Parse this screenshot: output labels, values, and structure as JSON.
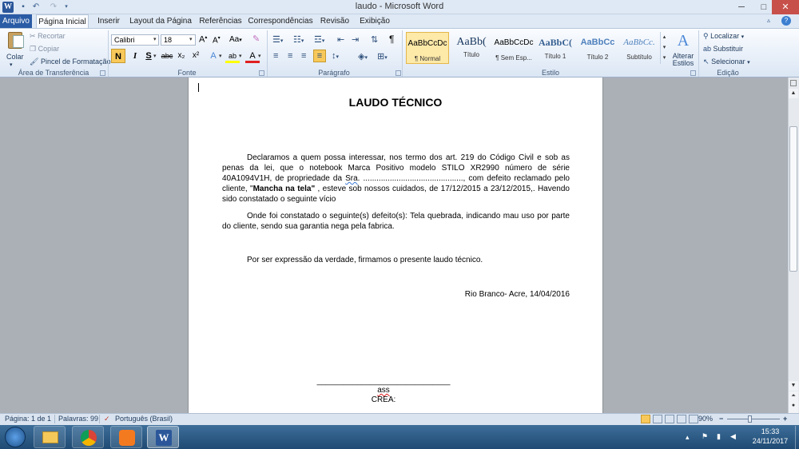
{
  "window": {
    "title": "laudo - Microsoft Word",
    "minimize": "─",
    "maximize": "□",
    "close": "✕"
  },
  "qat": {
    "app_icon": "W",
    "save": "💾",
    "undo": "↶",
    "redo": "↷"
  },
  "tabs": [
    {
      "label": "Arquivo"
    },
    {
      "label": "Página Inicial"
    },
    {
      "label": "Inserir"
    },
    {
      "label": "Layout da Página"
    },
    {
      "label": "Referências"
    },
    {
      "label": "Correspondências"
    },
    {
      "label": "Revisão"
    },
    {
      "label": "Exibição"
    }
  ],
  "ribbon": {
    "clipboard": {
      "group": "Área de Transferência",
      "paste": "Colar",
      "cut": "Recortar",
      "copy": "Copiar",
      "format_painter": "Pincel de Formatação"
    },
    "font": {
      "group": "Fonte",
      "font_name": "Calibri",
      "font_size": "18",
      "bold": "N",
      "italic": "I",
      "underline": "S",
      "strike": "abc",
      "sub": "x₂",
      "sup": "x²",
      "grow": "A",
      "shrink": "A",
      "case": "Aa",
      "effects": "A",
      "highlight": "ab",
      "color": "A"
    },
    "paragraph": {
      "group": "Parágrafo",
      "show_marks": "¶"
    },
    "styles": {
      "group": "Estilo",
      "change": "Alterar Estilos",
      "items": [
        {
          "preview": "AaBbCcDc",
          "name": "¶ Normal"
        },
        {
          "preview": "AaBb(",
          "name": "Título"
        },
        {
          "preview": "AaBbCcDc",
          "name": "¶ Sem Esp..."
        },
        {
          "preview": "AaBbC(",
          "name": "Título 1"
        },
        {
          "preview": "AaBbCc",
          "name": "Título 2"
        },
        {
          "preview": "AaBbCc.",
          "name": "Subtítulo"
        }
      ]
    },
    "editing": {
      "group": "Edição",
      "find": "Localizar",
      "replace": "Substituir",
      "select": "Selecionar"
    }
  },
  "document": {
    "title": "LAUDO TÉCNICO",
    "p1_a": "Declaramos a quem possa interessar, nos termo dos art. 219 do Código Civil e sob as penas da lei, que o notebook Marca Positivo modelo STILO XR2990 número de série 40A1094V1H, de propriedade da ",
    "p1_sra": "Sra",
    "p1_b": ". .............................................,  com defeito reclamado  pelo cliente, \"",
    "p1_bold": "Mancha na tela\"",
    "p1_c": " , esteve sob nossos cuidados, de 17/12/2015 a 23/12/2015,.  Havendo sido constatado o seguinte vício",
    "p2": "Onde foi constatado o seguinte(s) defeito(s): Tela quebrada, indicando mau uso por parte do cliente, sendo sua garantia nega pela fabrica.",
    "p3": "Por ser expressão da verdade, firmamos o presente laudo técnico.",
    "place_date": "Rio Branco- Acre, 14/04/2016",
    "signature_line": "______________________________",
    "sig_ass": "ass",
    "sig_crea": "CREA:"
  },
  "statusbar": {
    "page": "Página: 1 de 1",
    "words": "Palavras: 99",
    "language": "Português (Brasil)",
    "zoom": "90%"
  },
  "taskbar": {
    "time": "15:33",
    "date": "24/11/2017"
  },
  "colors": {
    "accent": "#2a5ba5",
    "ribbon": "#dfe9f5",
    "page": "#ffffff",
    "background": "#abb0b7"
  }
}
